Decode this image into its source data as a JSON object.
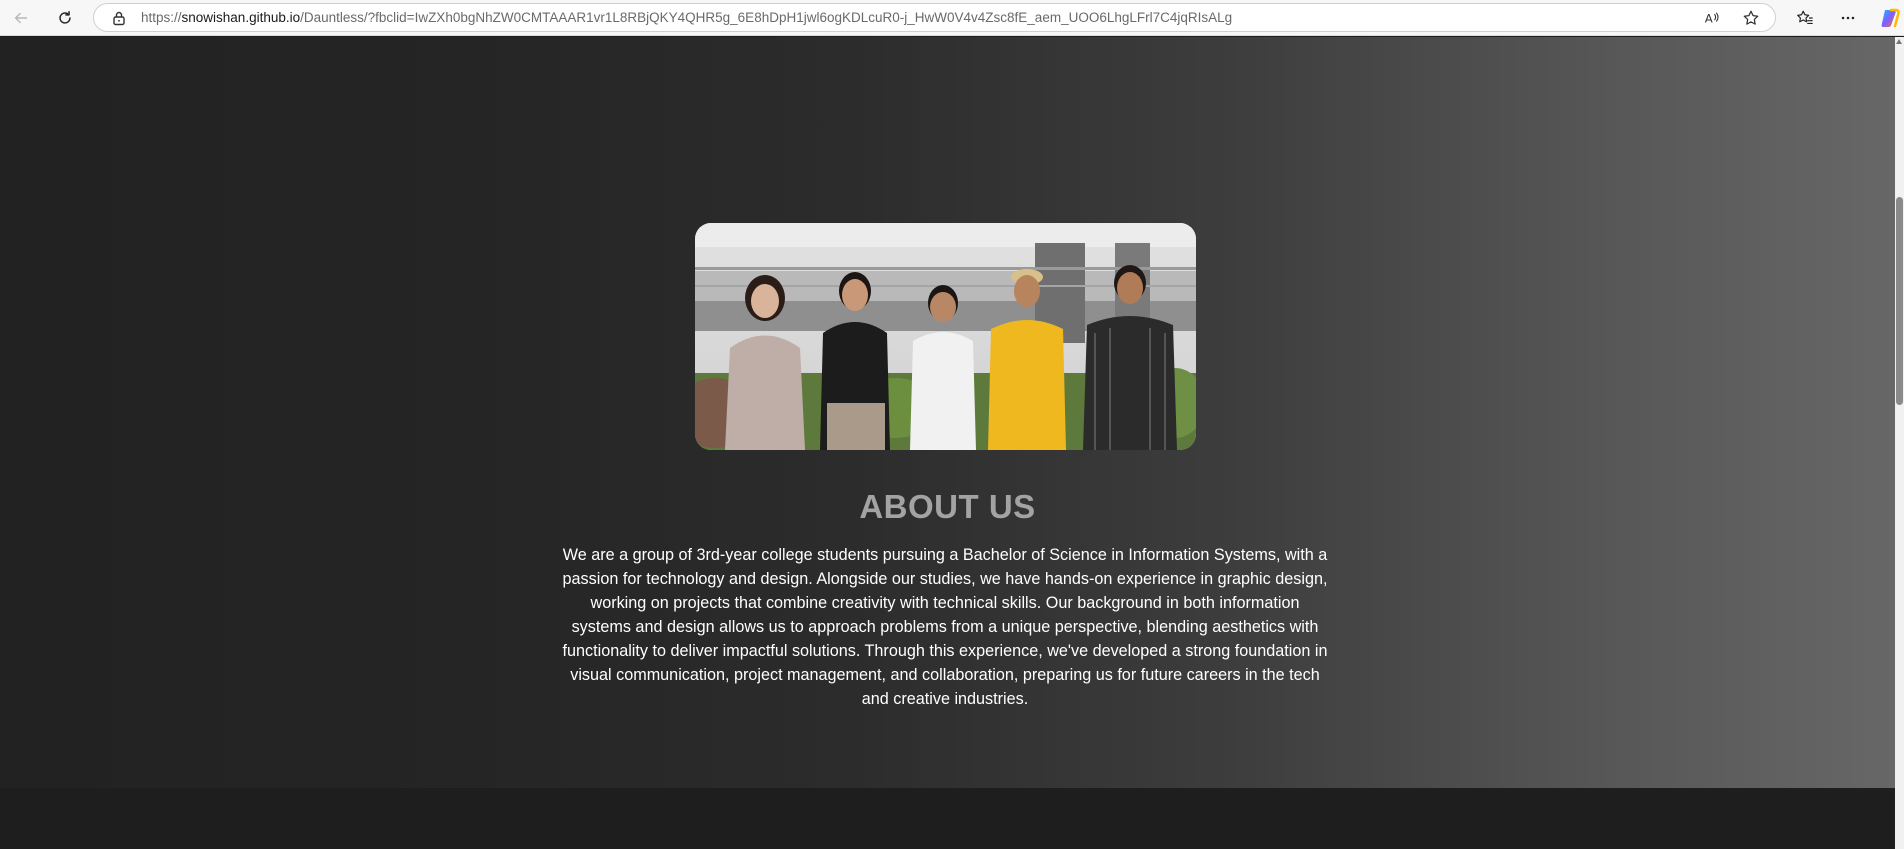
{
  "browser": {
    "url_prefix": "https://",
    "url_host": "snowishan.github.io",
    "url_rest": "/Dauntless/?fbclid=IwZXh0bgNhZW0CMTAAAR1vr1L8RBjQKY4QHR5g_6E8hDpH1jwl6ogKDLcuR0-j_HwW0V4v4Zsc8fE_aem_UOO6LhgLFrl7C4jqRIsALg",
    "icons": {
      "back": "back-arrow-icon",
      "refresh": "refresh-icon",
      "lock": "lock-icon",
      "read_aloud": "read-aloud-icon",
      "favorite": "star-icon",
      "favorites_list": "favorites-icon",
      "menu": "more-icon",
      "copilot": "copilot-icon"
    }
  },
  "about": {
    "title": "ABOUT US",
    "description": "We are a group of 3rd-year college students pursuing a Bachelor of Science in Information Systems, with a passion for technology and design. Alongside our studies, we have hands-on experience in graphic design, working on projects that combine creativity with technical skills. Our background in both information systems and design allows us to approach problems from a unique perspective, blending aesthetics with functionality to deliver impactful solutions. Through this experience, we've developed a strong foundation in visual communication, project management, and collaboration, preparing us for future careers in the tech and creative industries."
  },
  "colors": {
    "title": "#a3a3a3",
    "text": "#ffffff",
    "section_dark": "#222222",
    "section_light": "#676767"
  }
}
